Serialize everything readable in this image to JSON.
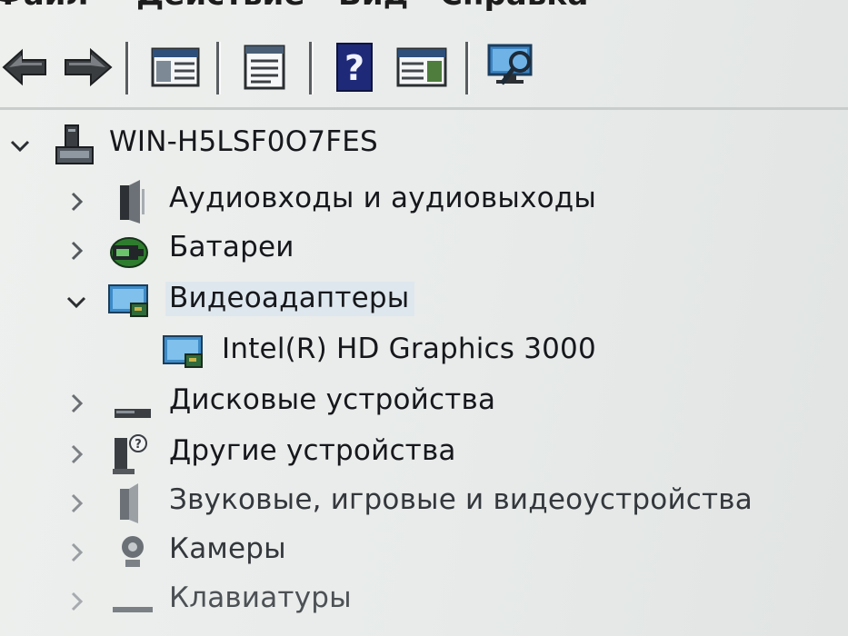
{
  "menu": {
    "items": [
      "Файл",
      "Действие",
      "Вид",
      "Справка"
    ]
  },
  "toolbar": {
    "buttons": [
      {
        "name": "back-icon"
      },
      {
        "name": "forward-icon"
      },
      {
        "name": "show-hide-console-tree-icon"
      },
      {
        "name": "properties-icon"
      },
      {
        "name": "help-icon"
      },
      {
        "name": "show-hide-action-pane-icon"
      },
      {
        "name": "scan-hardware-changes-icon"
      }
    ]
  },
  "tree": {
    "root": {
      "label": "WIN-H5LSF0O7FES",
      "expanded": true,
      "icon": "computer-icon"
    },
    "categories": [
      {
        "label": "Аудиовходы и аудиовыходы",
        "icon": "speaker-icon",
        "expanded": false
      },
      {
        "label": "Батареи",
        "icon": "battery-icon",
        "expanded": false
      },
      {
        "label": "Видеоадаптеры",
        "icon": "display-adapter-icon",
        "expanded": true,
        "selected": true,
        "children": [
          {
            "label": "Intel(R) HD Graphics 3000",
            "icon": "display-adapter-icon"
          }
        ]
      },
      {
        "label": "Дисковые устройства",
        "icon": "disk-drive-icon",
        "expanded": false
      },
      {
        "label": "Другие устройства",
        "icon": "unknown-device-icon",
        "expanded": false
      },
      {
        "label": "Звуковые, игровые и видеоустройства",
        "icon": "sound-video-game-icon",
        "expanded": false
      },
      {
        "label": "Камеры",
        "icon": "camera-icon",
        "expanded": false
      },
      {
        "label": "Клавиатуры",
        "icon": "keyboard-icon",
        "expanded": false
      }
    ]
  }
}
